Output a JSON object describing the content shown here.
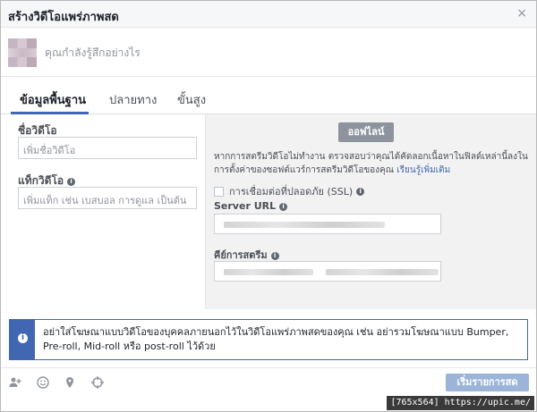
{
  "dialog": {
    "title": "สร้างวิดีโอแพร่ภาพสด",
    "close_symbol": "×"
  },
  "status": {
    "placeholder": "คุณกำลังรู้สึกอย่างไร"
  },
  "tabs": [
    {
      "label": "ข้อมูลพื้นฐาน",
      "active": true
    },
    {
      "label": "ปลายทาง",
      "active": false
    },
    {
      "label": "ขั้นสูง",
      "active": false
    }
  ],
  "basic": {
    "video_name_label": "ชื่อวิดีโอ",
    "video_name_placeholder": "เพิ่มชื่อวิดีโอ",
    "tags_label": "แท็กวิดีโอ",
    "tags_placeholder": "เพิ่มแท็ก เช่น เบสบอล การดูแล เป็นต้น"
  },
  "stream": {
    "status_badge": "ออฟไลน์",
    "help_text": "หากการสตรีมวิดีโอไม่ทำงาน ตรวจสอบว่าคุณได้คัดลอกเนื้อหาในฟิลด์เหล่านี้ลงในการตั้งค่าของซอฟต์แวร์การสตรีมวิดีโอของคุณ",
    "learn_more": "เรียนรู้เพิ่มเติม",
    "ssl_label": "การเชื่อมต่อที่ปลอดภัย (SSL)",
    "server_url_label": "Server URL",
    "stream_key_label": "คีย์การสตรีม"
  },
  "notice": {
    "text": "อย่าใส่โฆษณาแบบวิดีโอของบุคคลภายนอกไว้ในวิดีโอแพร่ภาพสดของคุณ เช่น อย่ารวมโฆษณาแบบ Bumper, Pre-roll, Mid-roll หรือ post-roll ไว้ด้วย"
  },
  "footer": {
    "icons": [
      "tag-people-icon",
      "emoji-icon",
      "location-pin-icon",
      "crosshair-icon"
    ],
    "start_button": "เริ่มรายการสด"
  },
  "watermark": "[765x564] https://upic.me/",
  "colors": {
    "accent": "#4267b2",
    "badge_gray": "#8d949e",
    "button_disabled": "#9cb4d8",
    "right_pane_bg": "#f2f2f2"
  }
}
